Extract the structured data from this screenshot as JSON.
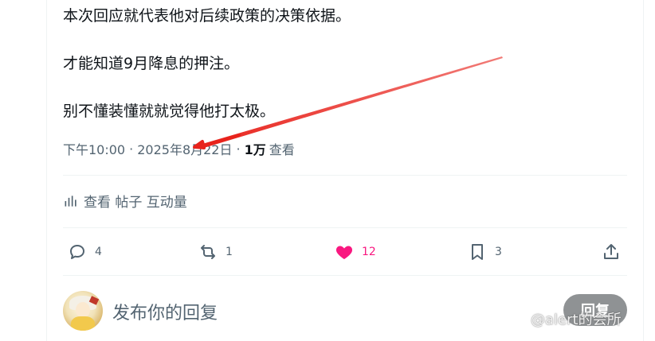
{
  "tweet": {
    "lines": [
      "本次回应就代表他对后续政策的决策依据。",
      "才能知道9月降息的押注。",
      "别不懂装懂就就觉得他打太极。"
    ],
    "time": "下午10:00",
    "separator": "·",
    "date": "2025年8月22日",
    "views_count": "1万",
    "views_label": "查看"
  },
  "engagements": {
    "label": "查看 帖子 互动量",
    "icon": "analytics-icon"
  },
  "actions": {
    "reply": {
      "icon": "reply-icon",
      "count": "4"
    },
    "retweet": {
      "icon": "retweet-icon",
      "count": "1"
    },
    "like": {
      "icon": "heart-icon",
      "count": "12",
      "color": "#f91880",
      "liked": true
    },
    "bookmark": {
      "icon": "bookmark-icon",
      "count": "3"
    },
    "share": {
      "icon": "share-icon"
    }
  },
  "reply_box": {
    "placeholder": "发布你的回复",
    "button_label": "回复"
  },
  "watermark": {
    "text": "@alert的会所"
  },
  "annotation": {
    "arrow_color": "#e8231c"
  }
}
